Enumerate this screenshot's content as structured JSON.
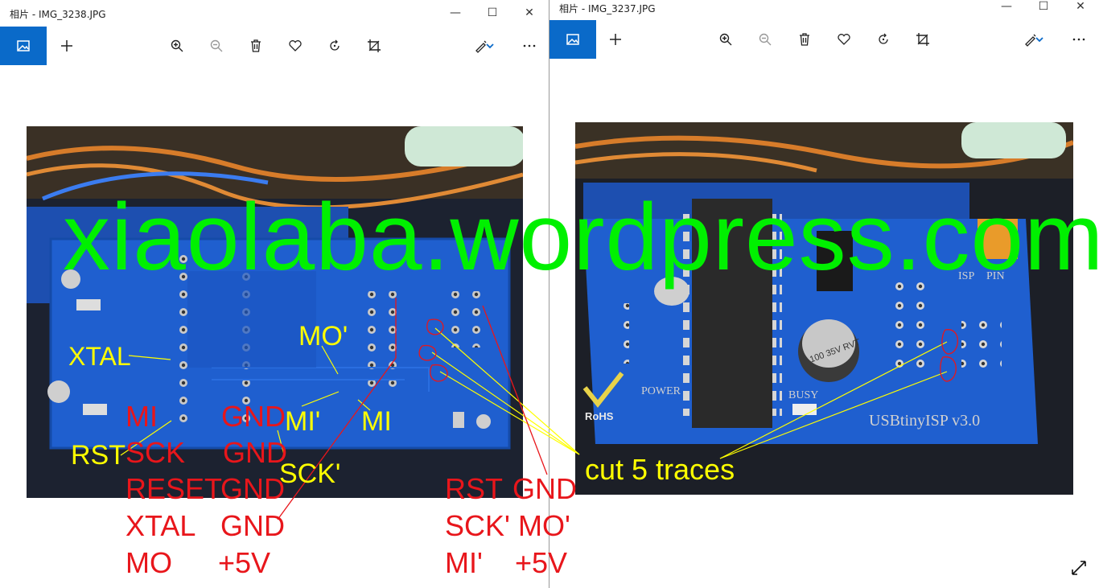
{
  "left_window": {
    "title": "相片 - IMG_3238.JPG",
    "controls": {
      "minimize": "—",
      "maximize": "☐",
      "close": "✕"
    }
  },
  "right_window": {
    "title": "相片 - IMG_3237.JPG",
    "controls": {
      "minimize": "—",
      "maximize": "☐",
      "close": "✕"
    }
  },
  "toolbar_icons": [
    "image-icon",
    "add-icon",
    "zoom-in-icon",
    "zoom-out-icon",
    "delete-icon",
    "favorite-icon",
    "rotate-icon",
    "crop-icon",
    "edit-icon",
    "chevron-down-icon",
    "more-icon"
  ],
  "watermark": "xiaolaba.wordpress.com",
  "labels": {
    "xtal_y": "XTAL",
    "mo_prime_y": "MO'",
    "mi_prime_y": "MI'",
    "mi_y": "MI",
    "rst_y": "RST",
    "sck_prime_y": "SCK'",
    "cut": "cut 5 traces",
    "left_col": [
      "MI",
      "SCK",
      "RESET",
      "XTAL",
      "MO"
    ],
    "mid_col": [
      "GND",
      "GND",
      "GND",
      "GND",
      "+5V"
    ],
    "right_col1": [
      "RST",
      "SCK'",
      "MI'"
    ],
    "right_col2": [
      "GND",
      "MO'",
      "+5V"
    ],
    "board_text": [
      "USBtinyISP  v3.0",
      "POWER",
      "BUSY",
      "RoHS",
      "ISP",
      "PIN",
      "100 35V RVT"
    ]
  },
  "colors": {
    "accent": "#0a6ac9",
    "label_red": "#e8161b",
    "label_yellow": "#ffff00",
    "watermark": "#00f000",
    "pcb": "#1f5fcf"
  }
}
